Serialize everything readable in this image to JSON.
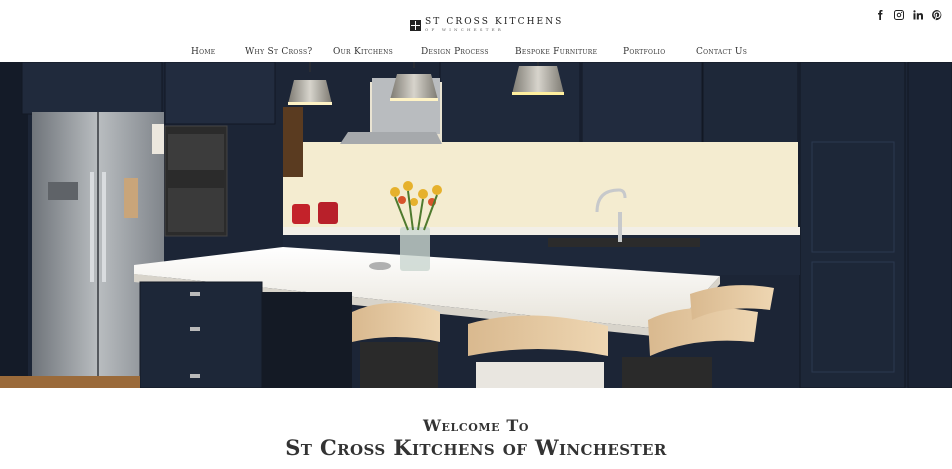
{
  "brand": {
    "name": "ST CROSS KITCHENS",
    "tagline": "OF WINCHESTER"
  },
  "social": [
    {
      "icon": "facebook-icon"
    },
    {
      "icon": "instagram-icon"
    },
    {
      "icon": "linkedin-icon"
    },
    {
      "icon": "pinterest-icon"
    }
  ],
  "nav": {
    "items": [
      {
        "label": "Home"
      },
      {
        "label": "Why St Cross?"
      },
      {
        "label": "Our Kitchens"
      },
      {
        "label": "Design Process"
      },
      {
        "label": "Bespoke Furniture"
      },
      {
        "label": "Portfolio"
      },
      {
        "label": "Contact Us"
      }
    ]
  },
  "hero": {
    "alt": ""
  },
  "welcome": {
    "line1": "Welcome To",
    "line2": "St Cross Kitchens of Winchester"
  },
  "colors": {
    "cabinet": "#1d2738",
    "worktop": "#f1eee6",
    "splashback": "#f6efd6",
    "text": "#333333"
  }
}
